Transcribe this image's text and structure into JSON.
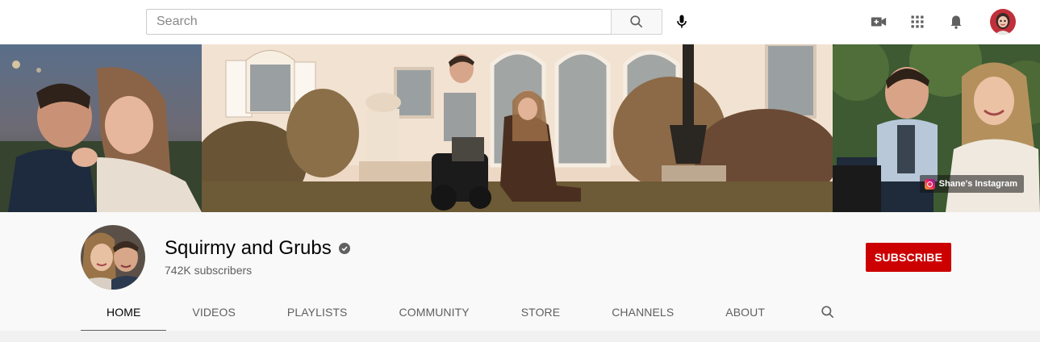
{
  "search": {
    "placeholder": "Search"
  },
  "icons": {
    "search": "search-icon",
    "mic": "microphone-icon",
    "create": "video-camera-plus-icon",
    "apps": "apps-grid-icon",
    "notifications": "bell-icon",
    "account": "account-avatar"
  },
  "banner": {
    "link_label": "Shane's Instagram"
  },
  "channel": {
    "name": "Squirmy and Grubs",
    "subscribers": "742K subscribers",
    "subscribe_label": "SUBSCRIBE"
  },
  "tabs": [
    {
      "label": "HOME",
      "active": true
    },
    {
      "label": "VIDEOS",
      "active": false
    },
    {
      "label": "PLAYLISTS",
      "active": false
    },
    {
      "label": "COMMUNITY",
      "active": false
    },
    {
      "label": "STORE",
      "active": false
    },
    {
      "label": "CHANNELS",
      "active": false
    },
    {
      "label": "ABOUT",
      "active": false
    }
  ],
  "colors": {
    "subscribe": "#cc0000",
    "page_bg": "#f9f9f9",
    "text_secondary": "#606060"
  }
}
